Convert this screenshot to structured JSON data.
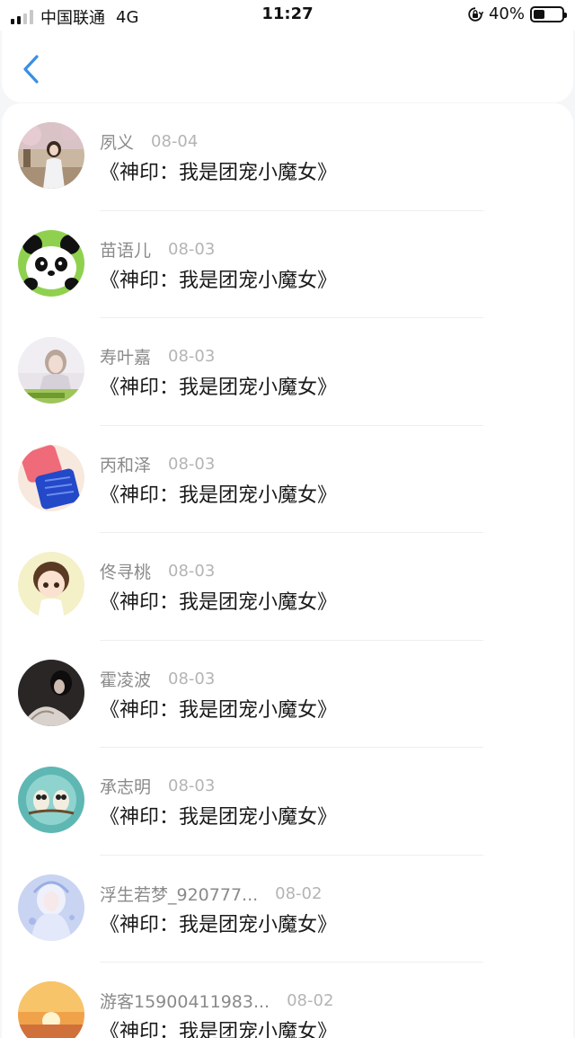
{
  "status_bar": {
    "carrier": "中国联通",
    "network": "4G",
    "time": "11:27",
    "battery": "40%",
    "battery_level": 0.4
  },
  "nav": {
    "back_icon": "chevron-left-icon",
    "accent_color": "#3a8ee6"
  },
  "comments": [
    {
      "name": "夙义",
      "date": "08-04",
      "title": "《神印：我是团宠小魔女》"
    },
    {
      "name": "苗语儿",
      "date": "08-03",
      "title": "《神印：我是团宠小魔女》"
    },
    {
      "name": "寿叶嘉",
      "date": "08-03",
      "title": "《神印：我是团宠小魔女》"
    },
    {
      "name": "丙和泽",
      "date": "08-03",
      "title": "《神印：我是团宠小魔女》"
    },
    {
      "name": "佟寻桃",
      "date": "08-03",
      "title": "《神印：我是团宠小魔女》"
    },
    {
      "name": "霍凌波",
      "date": "08-03",
      "title": "《神印：我是团宠小魔女》"
    },
    {
      "name": "承志明",
      "date": "08-03",
      "title": "《神印：我是团宠小魔女》"
    },
    {
      "name": "浮生若梦_920777...",
      "date": "08-02",
      "title": "《神印：我是团宠小魔女》"
    },
    {
      "name": "游客15900411983...",
      "date": "08-02",
      "title": "《神印：我是团宠小魔女》"
    }
  ]
}
